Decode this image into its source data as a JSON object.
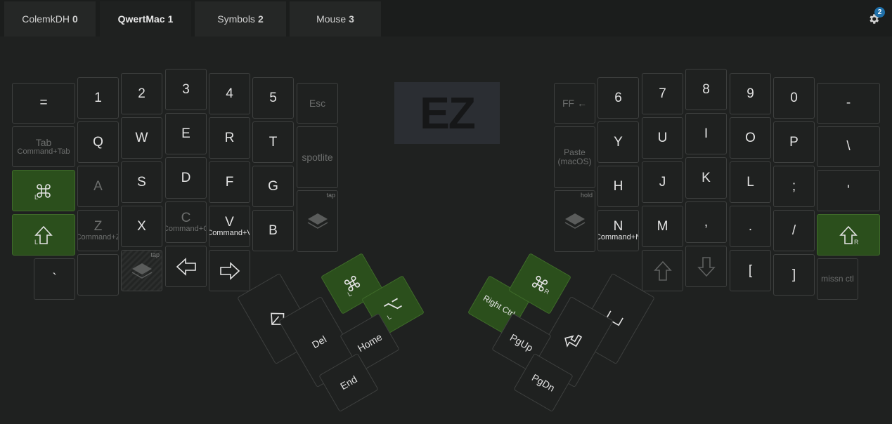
{
  "tabs": [
    {
      "label": "ColemkDH",
      "number": "0"
    },
    {
      "label": "QwertMac",
      "number": "1"
    },
    {
      "label": "Symbols",
      "number": "2"
    },
    {
      "label": "Mouse",
      "number": "3"
    }
  ],
  "settings": {
    "badge": "2"
  },
  "logo": "EZ",
  "left": {
    "row1": [
      "=",
      "1",
      "2",
      "3",
      "4",
      "5",
      "Esc"
    ],
    "row2": {
      "tab": "Tab",
      "tab_sub": "Command+Tab",
      "keys": [
        "Q",
        "W",
        "E",
        "R",
        "T"
      ],
      "spotlite": "spotlite"
    },
    "row3": {
      "cmd_mod": "L",
      "keys": [
        "A",
        "S",
        "D",
        "F",
        "G"
      ],
      "layer_hint": "tap"
    },
    "row4": {
      "shift_mod": "L",
      "z": "Z",
      "z_sub": "Command+Z",
      "x": "X",
      "c": "C",
      "c_sub": "Command+C",
      "v": "V",
      "v_sub": "Command+V",
      "b": "B"
    },
    "row5": {
      "grave": "`",
      "layer_hint": "tap"
    }
  },
  "left_thumb": {
    "cmd_mod": "L",
    "alt_mod": "L",
    "del": "Del",
    "home": "Home",
    "end": "End"
  },
  "right": {
    "row1": [
      "FF ←",
      "6",
      "7",
      "8",
      "9",
      "0",
      "-"
    ],
    "row2": {
      "paste": "Paste (macOS)",
      "keys": [
        "Y",
        "U",
        "I",
        "O",
        "P",
        "\\"
      ]
    },
    "row3": {
      "layer_hint": "hold",
      "keys": [
        "H",
        "J",
        "K",
        "L",
        ";",
        "'"
      ]
    },
    "row4": {
      "n": "N",
      "n_sub": "Command+N",
      "m": "M",
      "comma": ",",
      "period": ".",
      "slash": "/",
      "shift_mod": "R"
    },
    "row5": {
      "lbracket": "[",
      "rbracket": "]",
      "missn": "missn ctl"
    }
  },
  "right_thumb": {
    "rctrl": "Right Ctrl",
    "cmd_mod": "R",
    "pgup": "PgUp",
    "pgdn": "PgDn"
  },
  "colors": {
    "accent_green": "#2b4f1c",
    "background": "#1f2120",
    "badge": "#1f6fa8"
  }
}
